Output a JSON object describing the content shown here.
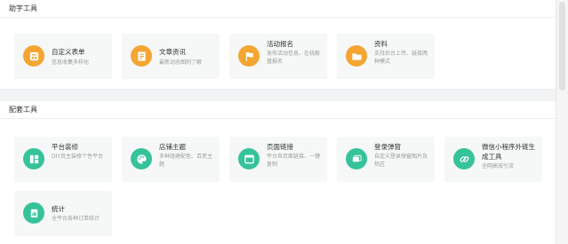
{
  "sections": [
    {
      "title": "助字工具",
      "cards": [
        {
          "title": "自定义表单",
          "desc": "信息收集多样化",
          "icon": "form-icon",
          "color": "#f5a532"
        },
        {
          "title": "文章资讯",
          "desc": "最新动态图则了解",
          "icon": "article-icon",
          "color": "#f5a532"
        },
        {
          "title": "活动报名",
          "desc": "发布活动信息、在线敝盘报名",
          "icon": "flag-icon",
          "color": "#f5a532"
        },
        {
          "title": "资料",
          "desc": "支持后台上传、链接两种模式",
          "icon": "folder-icon",
          "color": "#f5a532"
        }
      ]
    },
    {
      "title": "配套工具",
      "cards": [
        {
          "title": "平台装修",
          "desc": "DIY页主装修个性平台",
          "icon": "layout-icon",
          "color": "#36c39a"
        },
        {
          "title": "店铺主题",
          "desc": "多种组建配色、百变主题",
          "icon": "palette-icon",
          "color": "#36c39a"
        },
        {
          "title": "页面链接",
          "desc": "平台各页面链接、一键复制",
          "icon": "window-icon",
          "color": "#36c39a"
        },
        {
          "title": "登录弹窗",
          "desc": "自定义登录弹窗图片及热区",
          "icon": "popup-icon",
          "color": "#36c39a"
        },
        {
          "title": "微信小程序外链生成工具",
          "desc": "全网高效引流",
          "icon": "link-icon",
          "color": "#36c39a"
        },
        {
          "title": "统计",
          "desc": "全平台各种订单统计",
          "icon": "stats-icon",
          "color": "#36c39a"
        }
      ]
    }
  ]
}
